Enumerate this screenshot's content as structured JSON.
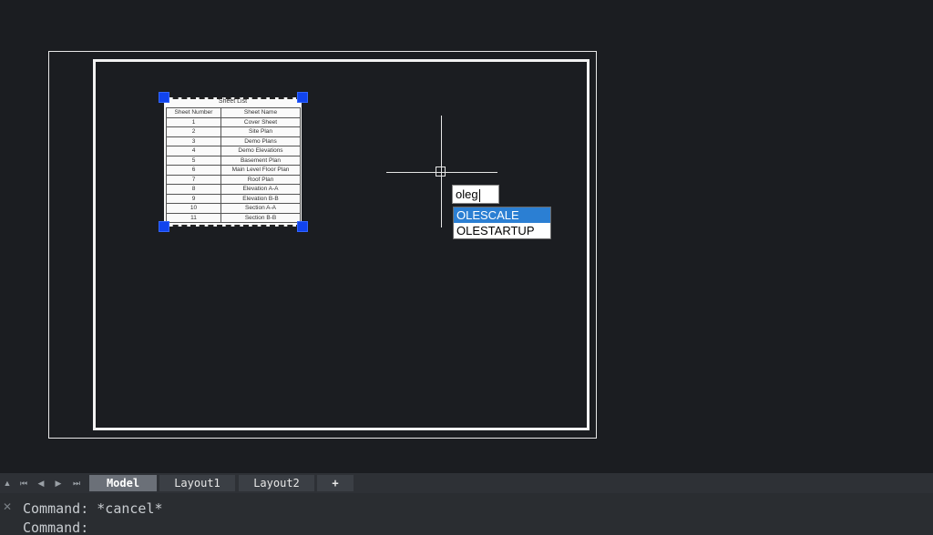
{
  "sheet_list": {
    "title": "Sheet List",
    "headers": [
      "Sheet Number",
      "Sheet Name"
    ],
    "rows": [
      [
        "1",
        "Cover Sheet"
      ],
      [
        "2",
        "Site Plan"
      ],
      [
        "3",
        "Demo Plans"
      ],
      [
        "4",
        "Demo Elevations"
      ],
      [
        "5",
        "Basement Plan"
      ],
      [
        "6",
        "Main Level Floor Plan"
      ],
      [
        "7",
        "Roof Plan"
      ],
      [
        "8",
        "Elevation A-A"
      ],
      [
        "9",
        "Elevation B-B"
      ],
      [
        "10",
        "Section A-A"
      ],
      [
        "11",
        "Section B-B"
      ]
    ]
  },
  "dynamic_input": {
    "value": "oleg"
  },
  "autocomplete": {
    "items": [
      "OLESCALE",
      "OLESTARTUP"
    ],
    "active_index": 0
  },
  "tabs": {
    "items": [
      "Model",
      "Layout1",
      "Layout2",
      "+"
    ],
    "active": "Model"
  },
  "command_line": {
    "lines": [
      "Command: *cancel*",
      "Command:"
    ]
  },
  "colors": {
    "background": "#1b1d21",
    "grip": "#1144ee",
    "highlight": "#2b7fd3"
  }
}
